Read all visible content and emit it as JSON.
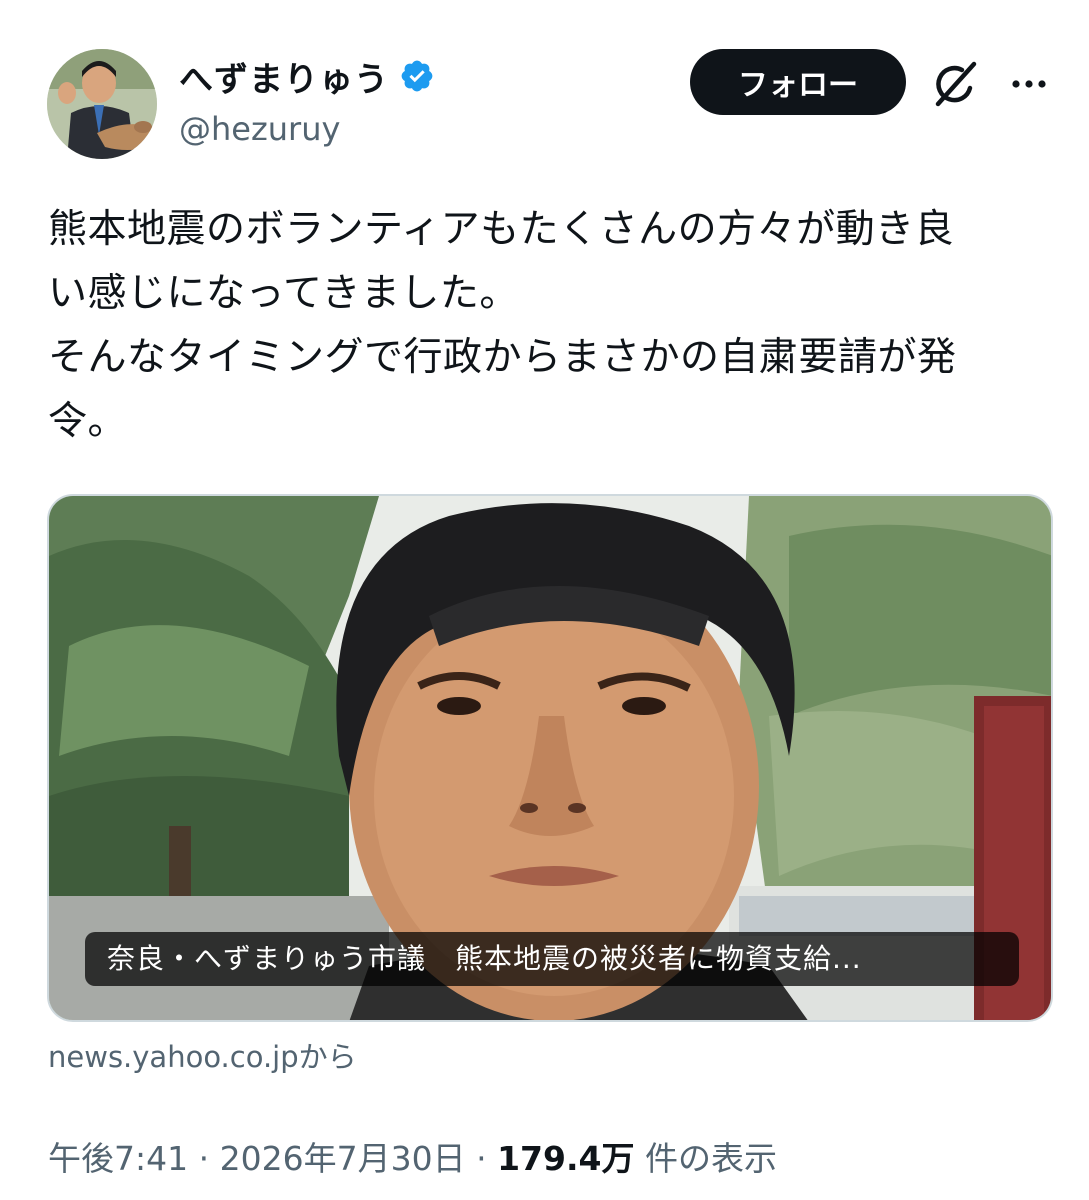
{
  "author": {
    "display_name": "へずまりゅう",
    "handle": "@hezuruy",
    "verified_color": "#1d9bf0"
  },
  "actions": {
    "follow_label": "フォロー",
    "grok_icon": "grok-icon",
    "more_icon": "more-icon"
  },
  "tweet": {
    "text": "熊本地震のボランティアもたくさんの方々が動き良\nい感じになってきました。\nそんなタイミングで行政からまさかの自粛要請が発\n令。"
  },
  "link_card": {
    "title": "奈良・へずまりゅう市議　熊本地震の被災者に物資支給...",
    "source": "news.yahoo.co.jpから"
  },
  "meta": {
    "time": "午後7:41",
    "sep1": " · ",
    "date": "2026年7月30日",
    "sep2": " · ",
    "views_count": "179.4万",
    "views_label": " 件の表示"
  }
}
